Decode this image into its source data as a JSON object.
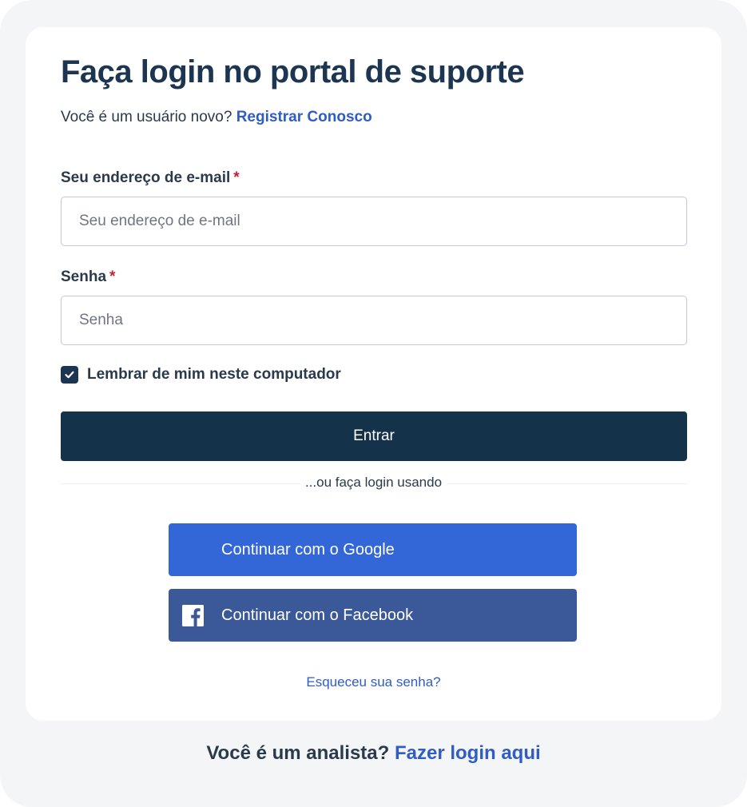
{
  "login": {
    "title": "Faça login no portal de suporte",
    "new_user_text": "Você é um usuário novo?",
    "register_link": "Registrar Conosco",
    "email_label": "Seu endereço de e-mail",
    "email_placeholder": "Seu endereço de e-mail",
    "email_value": "",
    "password_label": "Senha",
    "password_placeholder": "Senha",
    "password_value": "",
    "required_marker": "*",
    "remember_label": "Lembrar de mim neste computador",
    "remember_checked": true,
    "submit_label": "Entrar",
    "divider_text": "...ou faça login usando",
    "google_label": "Continuar com o Google",
    "facebook_label": "Continuar com o Facebook",
    "forgot_link": "Esqueceu sua senha?"
  },
  "footer": {
    "analyst_text": "Você é um analista?",
    "analyst_link": "Fazer login aqui"
  },
  "colors": {
    "primary_dark": "#15324b",
    "link": "#2f5cc7",
    "google": "#3366d6",
    "facebook": "#3b5998",
    "required": "#c4213a"
  },
  "icons": [
    "check-icon",
    "facebook-icon"
  ]
}
